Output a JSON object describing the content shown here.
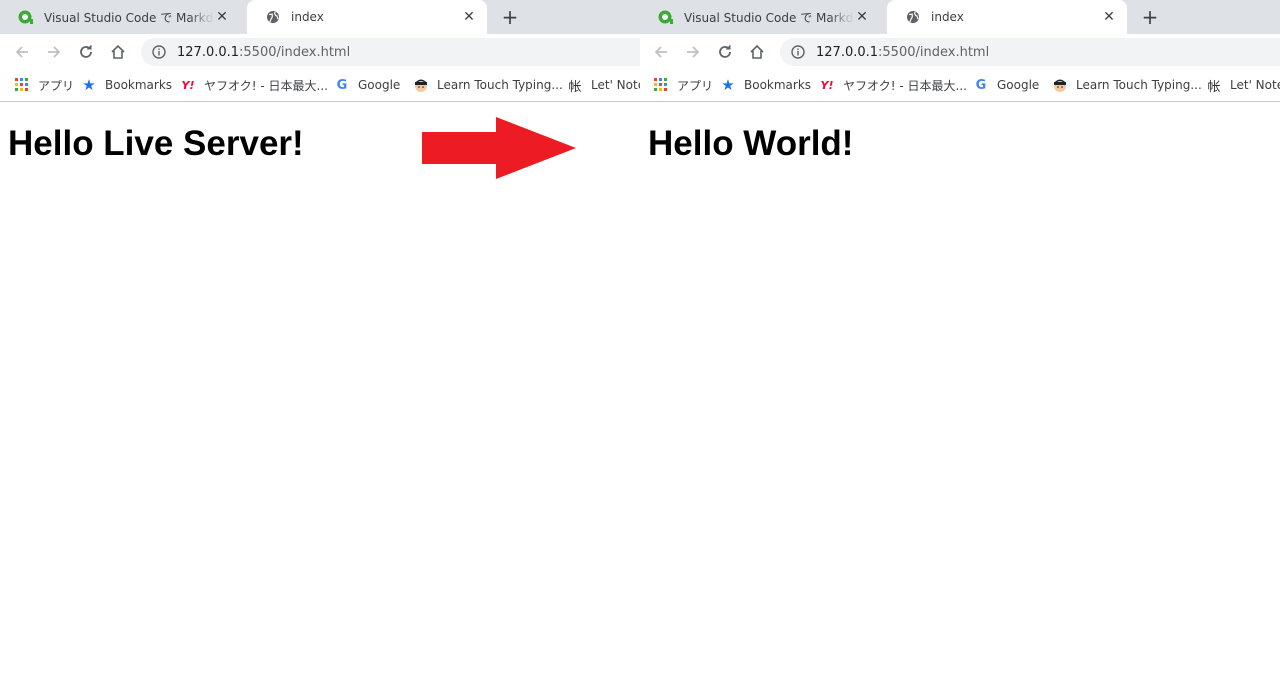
{
  "browsers": [
    {
      "tabs": [
        {
          "title": "Visual Studio Code で Markdown",
          "active": false
        },
        {
          "title": "index",
          "active": true
        }
      ],
      "url": {
        "host": "127.0.0.1",
        "rest": ":5500/index.html"
      },
      "bookmarks": [
        {
          "label": "アプリ",
          "icon": "apps-grid-icon"
        },
        {
          "label": "Bookmarks",
          "icon": "star-icon"
        },
        {
          "label": "ヤフオク! - 日本最大...",
          "icon": "yahoo-icon"
        },
        {
          "label": "Google",
          "icon": "google-icon"
        },
        {
          "label": "Learn Touch Typing...",
          "icon": "typing-avatar-icon"
        },
        {
          "label": "Let' Note",
          "icon": "kanji-icon"
        }
      ],
      "heading": "Hello Live Server!"
    },
    {
      "tabs": [
        {
          "title": "Visual Studio Code で Markdown",
          "active": false
        },
        {
          "title": "index",
          "active": true
        }
      ],
      "url": {
        "host": "127.0.0.1",
        "rest": ":5500/index.html"
      },
      "bookmarks": [
        {
          "label": "アプリ",
          "icon": "apps-grid-icon"
        },
        {
          "label": "Bookmarks",
          "icon": "star-icon"
        },
        {
          "label": "ヤフオク! - 日本最大...",
          "icon": "yahoo-icon"
        },
        {
          "label": "Google",
          "icon": "google-icon"
        },
        {
          "label": "Learn Touch Typing...",
          "icon": "typing-avatar-icon"
        },
        {
          "label": "Let' Note",
          "icon": "kanji-icon"
        }
      ],
      "heading": "Hello World!"
    }
  ],
  "bookmark_kanji_glyph": "帐",
  "colors": {
    "arrow": "#ed1c24",
    "tabstrip": "#dee1e6",
    "omnibox": "#f1f3f4",
    "star": "#1a73e8",
    "yahoo": "#ff0033"
  }
}
